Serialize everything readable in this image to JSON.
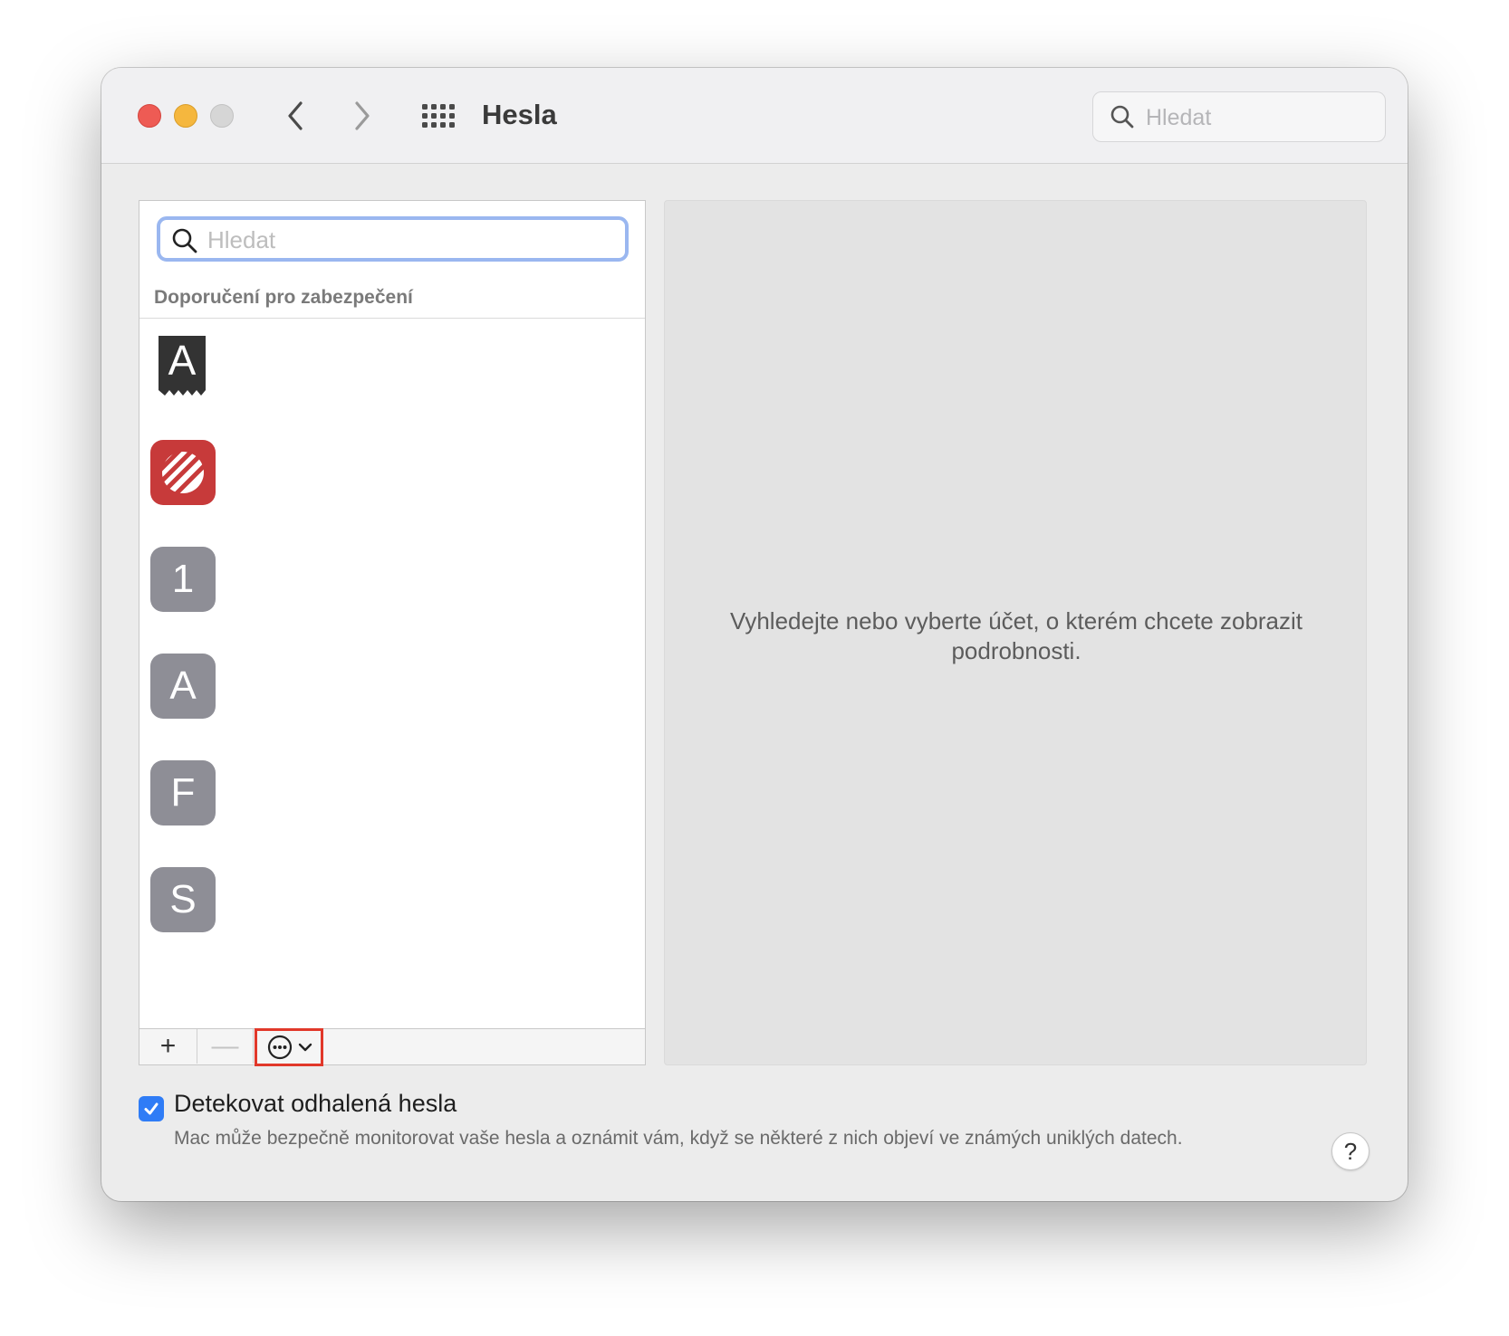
{
  "window": {
    "title": "Hesla",
    "search_placeholder": "Hledat"
  },
  "icons": {
    "close": "close-traffic-light",
    "minimize": "minimize-traffic-light",
    "zoom": "zoom-traffic-light",
    "back": "chevron-left-icon",
    "forward": "chevron-right-icon",
    "grid": "grid-icon",
    "search": "search-icon",
    "more": "ellipsis-circle-icon",
    "help": "question-mark-icon"
  },
  "list": {
    "search_placeholder": "Hledat",
    "section_title": "Doporučení pro zabezpečení",
    "accounts": [
      {
        "icon": "app-icon-receipt-a",
        "letter": "A"
      },
      {
        "icon": "app-icon-red-stripes",
        "letter": ""
      },
      {
        "icon": "letter-avatar",
        "letter": "1"
      },
      {
        "icon": "letter-avatar",
        "letter": "A"
      },
      {
        "icon": "letter-avatar",
        "letter": "F"
      },
      {
        "icon": "letter-avatar",
        "letter": "S"
      }
    ],
    "toolbar": {
      "add_label": "+",
      "remove_label": "—"
    }
  },
  "detail": {
    "empty_message": "Vyhledejte nebo vyberte účet, o kterém chcete zobrazit podrobnosti."
  },
  "footer": {
    "detect_checked": true,
    "detect_label": "Detekovat odhalená hesla",
    "detect_description": "Mac může bezpečně monitorovat vaše hesla a oznámit vám, když se některé z nich objeví ve známých uniklých datech.",
    "help_label": "?"
  },
  "colors": {
    "accent": "#2f7cf6",
    "highlight_box": "#e1382a",
    "red_app": "#c73a3a",
    "letter_avatar": "#8e8e96"
  }
}
